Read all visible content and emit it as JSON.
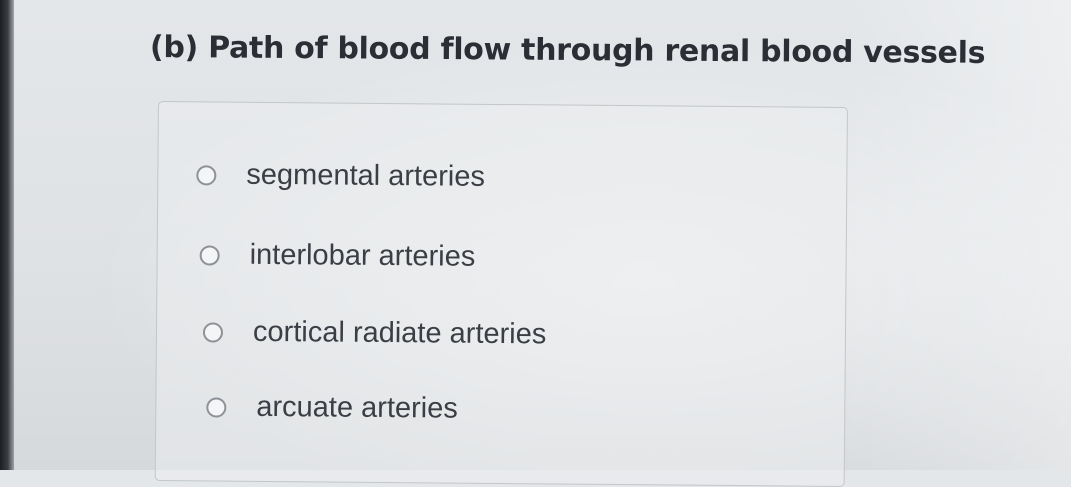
{
  "question": {
    "heading": "(b) Path of blood flow through renal blood vessels"
  },
  "options": [
    {
      "label": "segmental arteries",
      "selected": false
    },
    {
      "label": "interlobar arteries",
      "selected": false
    },
    {
      "label": "cortical radiate arteries",
      "selected": false
    },
    {
      "label": "arcuate arteries",
      "selected": false
    }
  ]
}
